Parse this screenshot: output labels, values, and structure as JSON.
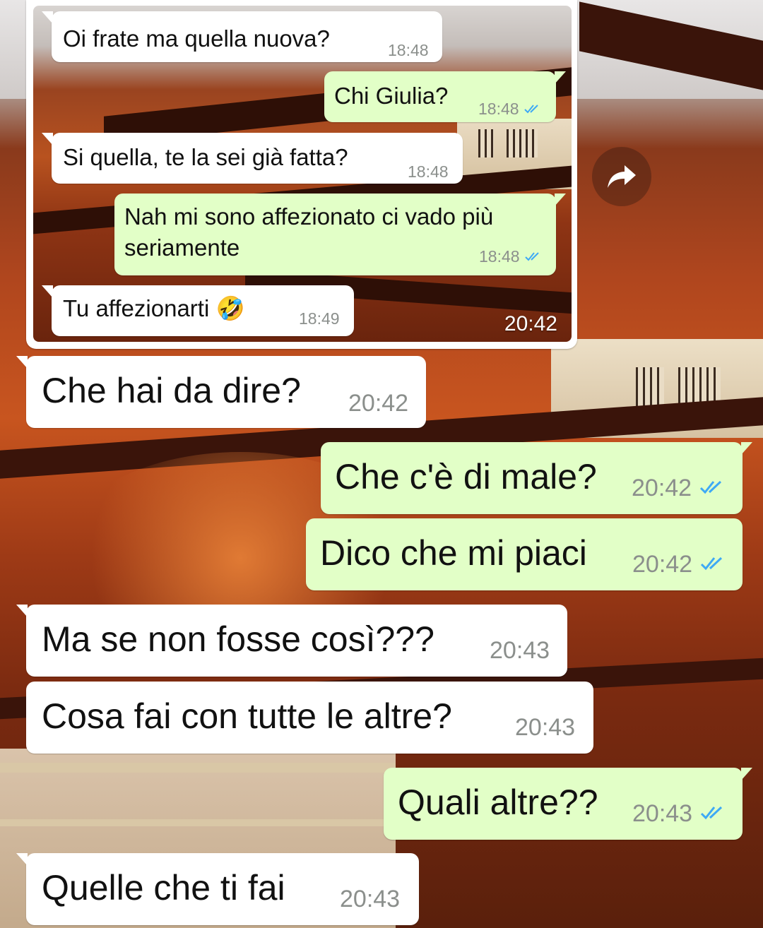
{
  "quoted": {
    "messages": [
      {
        "dir": "in",
        "text": "Oi frate ma quella nuova?",
        "time": "18:48"
      },
      {
        "dir": "out",
        "text": "Chi Giulia?",
        "time": "18:48",
        "ticks": true
      },
      {
        "dir": "in",
        "text": "Si quella, te la sei già fatta?",
        "time": "18:48"
      },
      {
        "dir": "out",
        "lines": [
          "Nah mi sono affezionato ci vado più",
          "seriamente"
        ],
        "time": "18:48",
        "ticks": true
      },
      {
        "dir": "in",
        "text": "Tu affezionarti",
        "emoji": "🤣",
        "time": "18:49"
      }
    ],
    "image_time": "20:42"
  },
  "messages": [
    {
      "dir": "in",
      "text": "Che hai da dire?",
      "time": "20:42"
    },
    {
      "dir": "out",
      "text": "Che c'è di male?",
      "time": "20:42",
      "ticks": true
    },
    {
      "dir": "out",
      "text": "Dico che mi piaci",
      "time": "20:42",
      "ticks": true
    },
    {
      "dir": "in",
      "text": "Ma se non fosse così???",
      "time": "20:43"
    },
    {
      "dir": "in",
      "text": "Cosa fai con tutte le altre?",
      "time": "20:43"
    },
    {
      "dir": "out",
      "text": "Quali altre??",
      "time": "20:43",
      "ticks": true
    },
    {
      "dir": "in",
      "text": "Quelle che ti fai",
      "time": "20:43"
    }
  ],
  "icons": {
    "forward": "forward-arrow-icon",
    "read_receipt": "double-check-icon"
  },
  "colors": {
    "incoming_bubble": "#ffffff",
    "outgoing_bubble": "#e2ffc7",
    "read_tick": "#3ea9f5",
    "timestamp": "#8b8f8c"
  }
}
